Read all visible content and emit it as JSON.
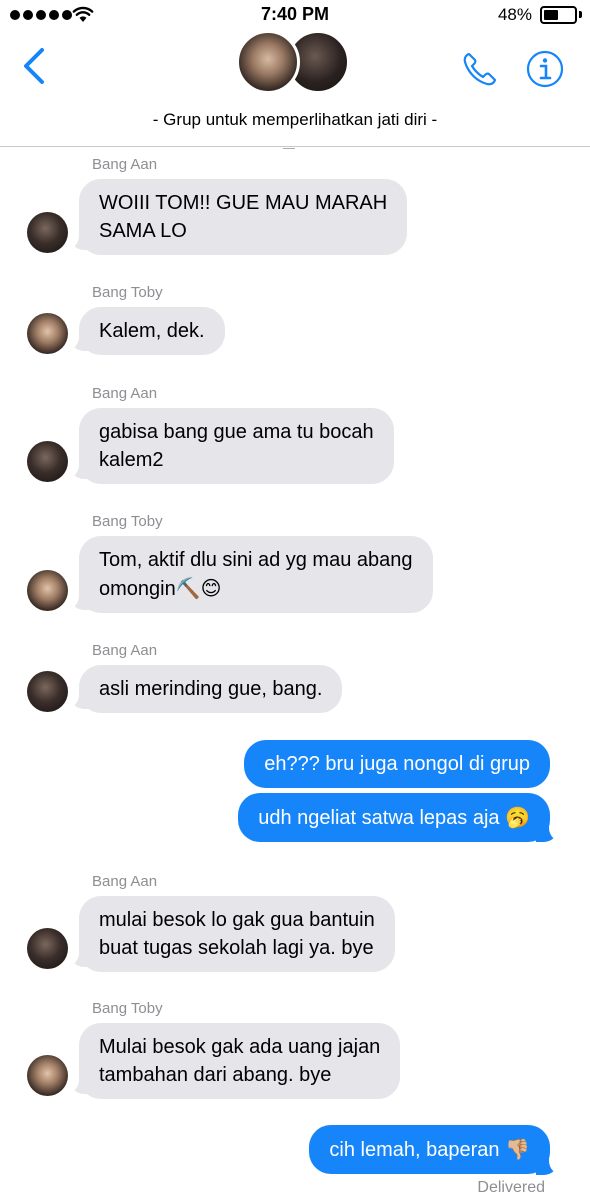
{
  "status_bar": {
    "time": "7:40 PM",
    "battery": "48%",
    "battery_level": 0.48,
    "signal_bars": 5,
    "icons": [
      "signal-icon",
      "wifi-icon",
      "battery-icon"
    ]
  },
  "header": {
    "group_name": "- Grup untuk memperlihatkan jati diri -",
    "icons": [
      "back-chevron-icon",
      "phone-icon",
      "info-icon"
    ],
    "accent": "#1585f9"
  },
  "messages": [
    {
      "sender": "Bang Aan",
      "text_line1": "WOIII TOM!! GUE MAU MARAH",
      "text_line2": "SAMA LO"
    },
    {
      "sender": "Bang Toby",
      "text": "Kalem, dek."
    },
    {
      "sender": "Bang Aan",
      "text_line1": "gabisa bang gue ama tu bocah",
      "text_line2": "kalem2"
    },
    {
      "sender": "Bang Toby",
      "text_line1": "Tom, aktif dlu sini ad yg mau abang",
      "text_line2": "omongin",
      "emoji": "⛏️😊"
    },
    {
      "sender": "Bang Aan",
      "text": "asli merinding gue, bang."
    },
    {
      "sender": "Me",
      "text": "eh??? bru juga nongol di grup"
    },
    {
      "sender": "Me",
      "text": "udh ngeliat satwa lepas aja",
      "emoji": "🥱"
    },
    {
      "sender": "Bang Aan",
      "text_line1": "mulai besok lo gak gua bantuin",
      "text_line2": "buat tugas sekolah lagi ya. bye"
    },
    {
      "sender": "Bang Toby",
      "text_line1": "Mulai besok gak ada uang jajan",
      "text_line2": "tambahan dari abang. bye"
    },
    {
      "sender": "Me",
      "text": "cih lemah, baperan",
      "emoji": "👎🏼"
    }
  ],
  "delivered_label": "Delivered",
  "colors": {
    "incoming_bubble": "#e5e5ea",
    "outgoing_bubble": "#1585f9",
    "sender_label": "#8e8e93"
  }
}
